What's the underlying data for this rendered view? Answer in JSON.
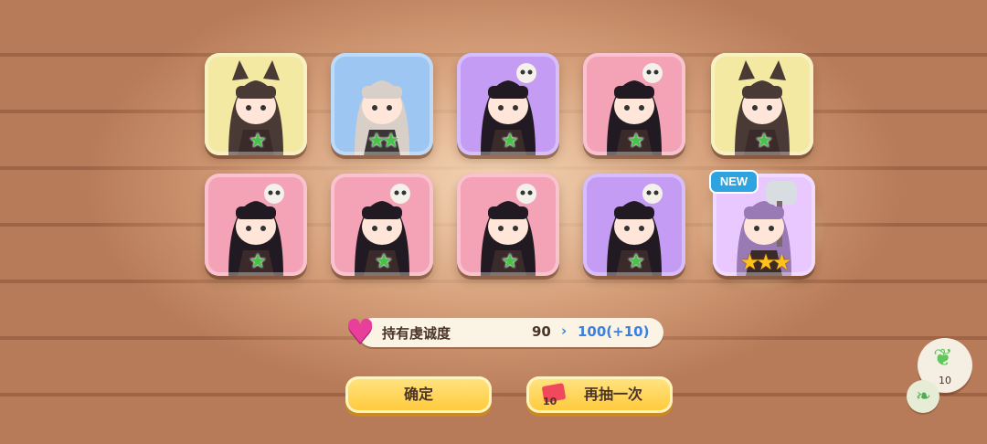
{
  "cards": [
    {
      "bg": "#f3e9a2",
      "name": "wolf-girl",
      "stars": "★",
      "star_type": "green"
    },
    {
      "bg": "#9dc6f2",
      "name": "silver-hair-girl",
      "stars": "★★",
      "star_type": "green"
    },
    {
      "bg": "#c49cf4",
      "name": "skull-girl-purple",
      "stars": "★",
      "star_type": "green"
    },
    {
      "bg": "#f4a3b6",
      "name": "skull-girl-pink",
      "stars": "★",
      "star_type": "green"
    },
    {
      "bg": "#f3e9a2",
      "name": "wolf-girl",
      "stars": "★",
      "star_type": "green"
    },
    {
      "bg": "#f4a3b6",
      "name": "skull-girl-pink",
      "stars": "★",
      "star_type": "green"
    },
    {
      "bg": "#f4a3b6",
      "name": "skull-girl-pink",
      "stars": "★",
      "star_type": "green"
    },
    {
      "bg": "#f4a3b6",
      "name": "skull-girl-pink",
      "stars": "★",
      "star_type": "green"
    },
    {
      "bg": "#c49cf4",
      "name": "skull-girl-purple",
      "stars": "★",
      "star_type": "green"
    },
    {
      "bg": "#e9c8ff",
      "name": "axe-girl",
      "stars": "★★★",
      "star_type": "gold",
      "new": true
    }
  ],
  "new_badge": "NEW",
  "piety": {
    "label": "持有虔诚度",
    "current": "90",
    "arrow": "›",
    "next": "100(+10)"
  },
  "buttons": {
    "confirm": "确定",
    "again": "再抽一次",
    "ticket_count": "10"
  },
  "side": {
    "resource_count": "10"
  },
  "colors": {
    "button": "#ffc938",
    "heart": "#e83f9a",
    "highlight": "#3b7fe0"
  }
}
